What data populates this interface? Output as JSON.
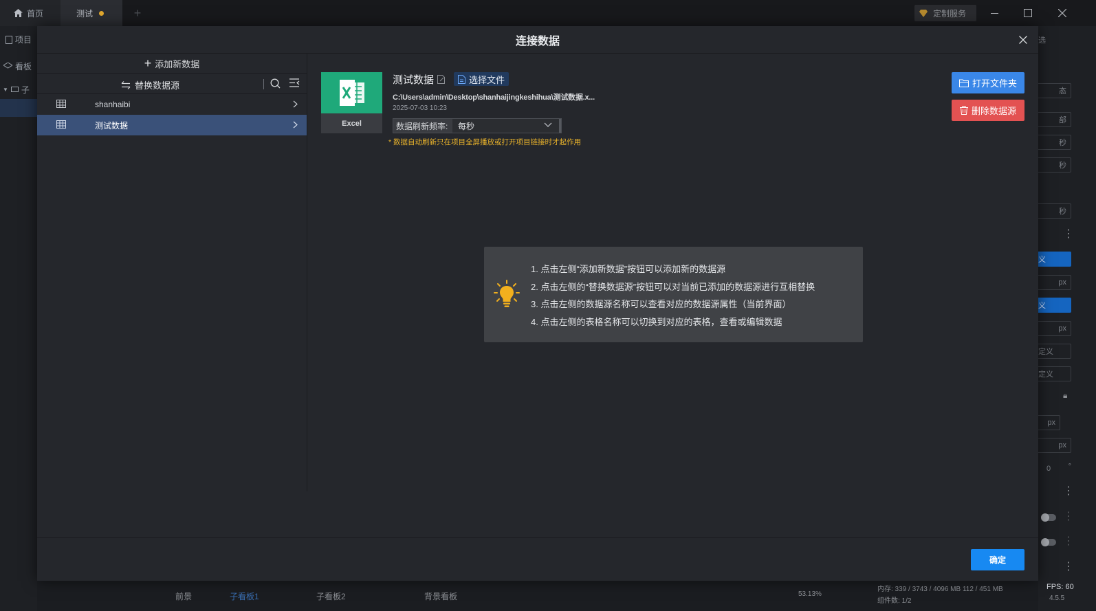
{
  "titlebar": {
    "tabs": [
      {
        "label": "首页"
      },
      {
        "label": "测试"
      }
    ],
    "custom_service": "定制服务",
    "colors": {
      "unsaved_dot": "#e3a92e"
    }
  },
  "background": {
    "left_items": [
      "项目",
      "看板",
      "子"
    ],
    "right_labels": [
      "选",
      "态",
      "部",
      "秒",
      "秒",
      "秒",
      "义",
      "px",
      "义",
      "px",
      "定义",
      "定义",
      "px",
      "px",
      "0",
      "°"
    ],
    "bottom": {
      "foreground": "前景",
      "board1": "子看板1",
      "board2": "子看板2",
      "bg_board": "背景看板",
      "zoom": "53.13%",
      "memory": "内存: 339 / 3743 / 4096 MB  112 / 451 MB",
      "components": "组件数: 1/2",
      "fps": "FPS: 60",
      "fps_sub": "4.5.5"
    }
  },
  "modal": {
    "title": "连接数据",
    "sidebar": {
      "add_label": "添加新数据",
      "replace_label": "替换数据源",
      "items": [
        {
          "name": "shanhaibi",
          "active": false
        },
        {
          "name": "测试数据",
          "active": true
        }
      ]
    },
    "detail": {
      "file_type": "Excel",
      "name": "测试数据",
      "choose_file": "选择文件",
      "path": "C:\\Users\\admin\\Desktop\\shanhaijingkeshihua\\测试数据.x...",
      "date": "2025-07-03 10:23",
      "refresh_label": "数据刷新频率:",
      "refresh_value": "每秒",
      "note": "* 数据自动刷新只在项目全屏播放或打开项目链接时才起作用",
      "open_folder": "打开文件夹",
      "delete_source": "删除数据源"
    },
    "tips": [
      "1. 点击左侧“添加新数据”按钮可以添加新的数据源",
      "2. 点击左侧的“替换数据源”按钮可以对当前已添加的数据源进行互相替换",
      "3. 点击左侧的数据源名称可以查看对应的数据源属性（当前界面）",
      "4. 点击左侧的表格名称可以切换到对应的表格，查看或编辑数据"
    ],
    "ok_label": "确定",
    "colors": {
      "primary": "#1789f2",
      "open_btn": "#3a87e8",
      "danger": "#e35252",
      "excel": "#1fa97a",
      "warning": "#e8b22b",
      "bulb": "#f2b01e"
    }
  }
}
